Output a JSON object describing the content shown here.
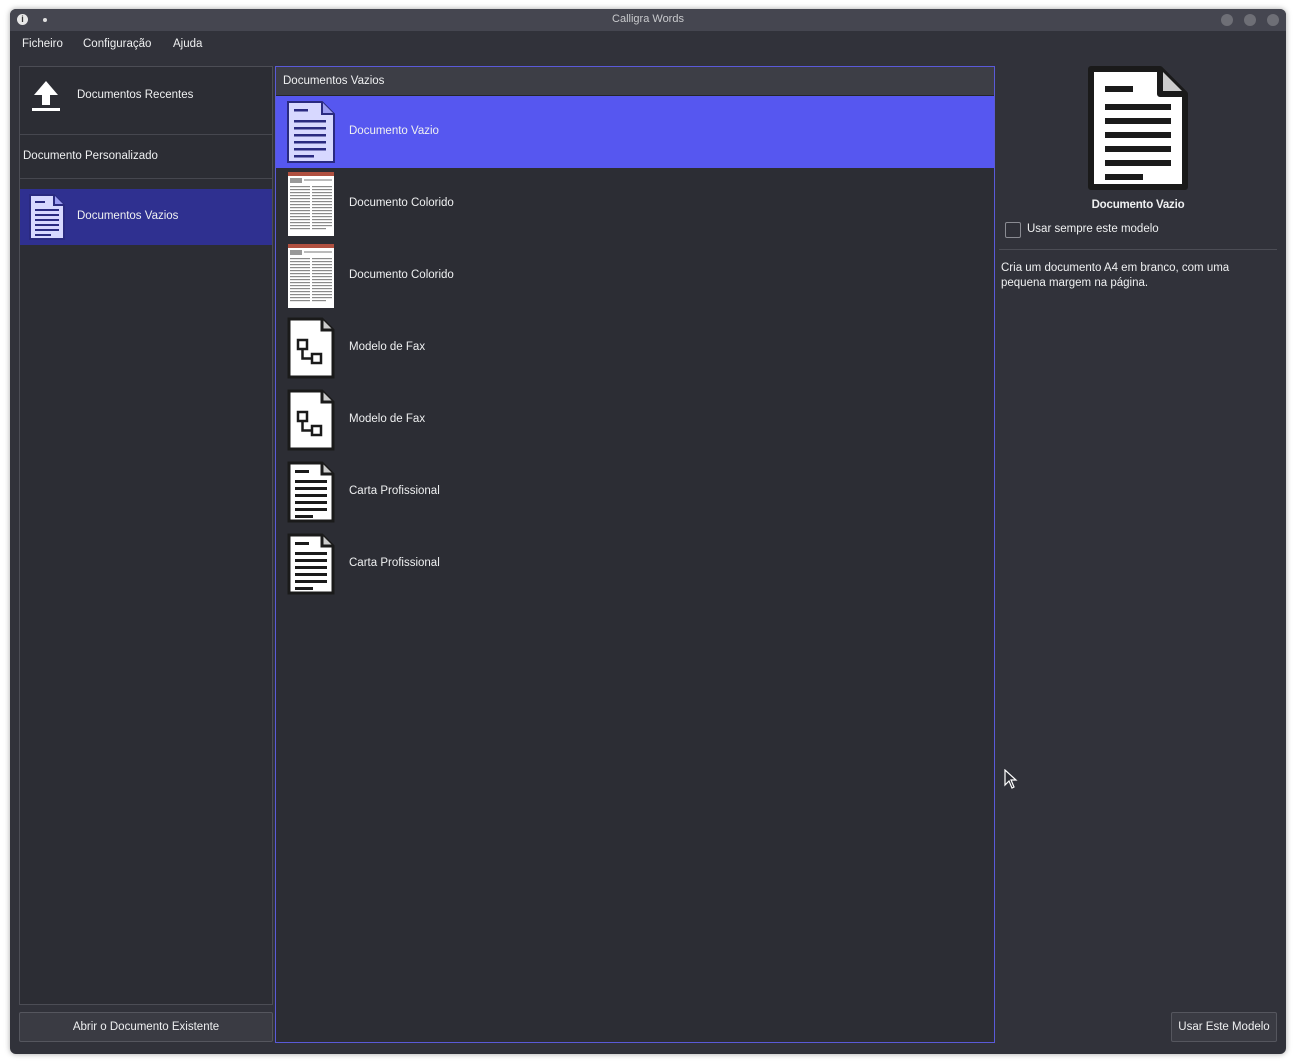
{
  "window": {
    "title": "Calligra Words"
  },
  "menu": {
    "items": [
      "Ficheiro",
      "Configuração",
      "Ajuda"
    ]
  },
  "categories": {
    "recent": "Documentos Recentes",
    "custom": "Documento Personalizado",
    "empty": "Documentos Vazios"
  },
  "open_button": "Abrir o Documento Existente",
  "templates": {
    "header": "Documentos Vazios",
    "items": [
      {
        "label": "Documento Vazio",
        "icon": "document-icon",
        "selected": true
      },
      {
        "label": "Documento Colorido",
        "icon": "colorful-document-thumbnail"
      },
      {
        "label": "Documento Colorido",
        "icon": "colorful-document-thumbnail"
      },
      {
        "label": "Modelo de Fax",
        "icon": "fax-template-icon"
      },
      {
        "label": "Modelo de Fax",
        "icon": "fax-template-icon"
      },
      {
        "label": "Carta Profissional",
        "icon": "letter-document-icon"
      },
      {
        "label": "Carta Profissional",
        "icon": "letter-document-icon"
      }
    ]
  },
  "preview": {
    "title": "Documento Vazio",
    "always_use_label": "Usar sempre este modelo",
    "always_use_checked": false,
    "description": "Cria um documento A4 em branco, com uma pequena margem na página."
  },
  "use_button": "Usar Este Modelo",
  "colors": {
    "selection": "#5657f0",
    "category_selected": "#2f3090",
    "background": "#31323a"
  }
}
